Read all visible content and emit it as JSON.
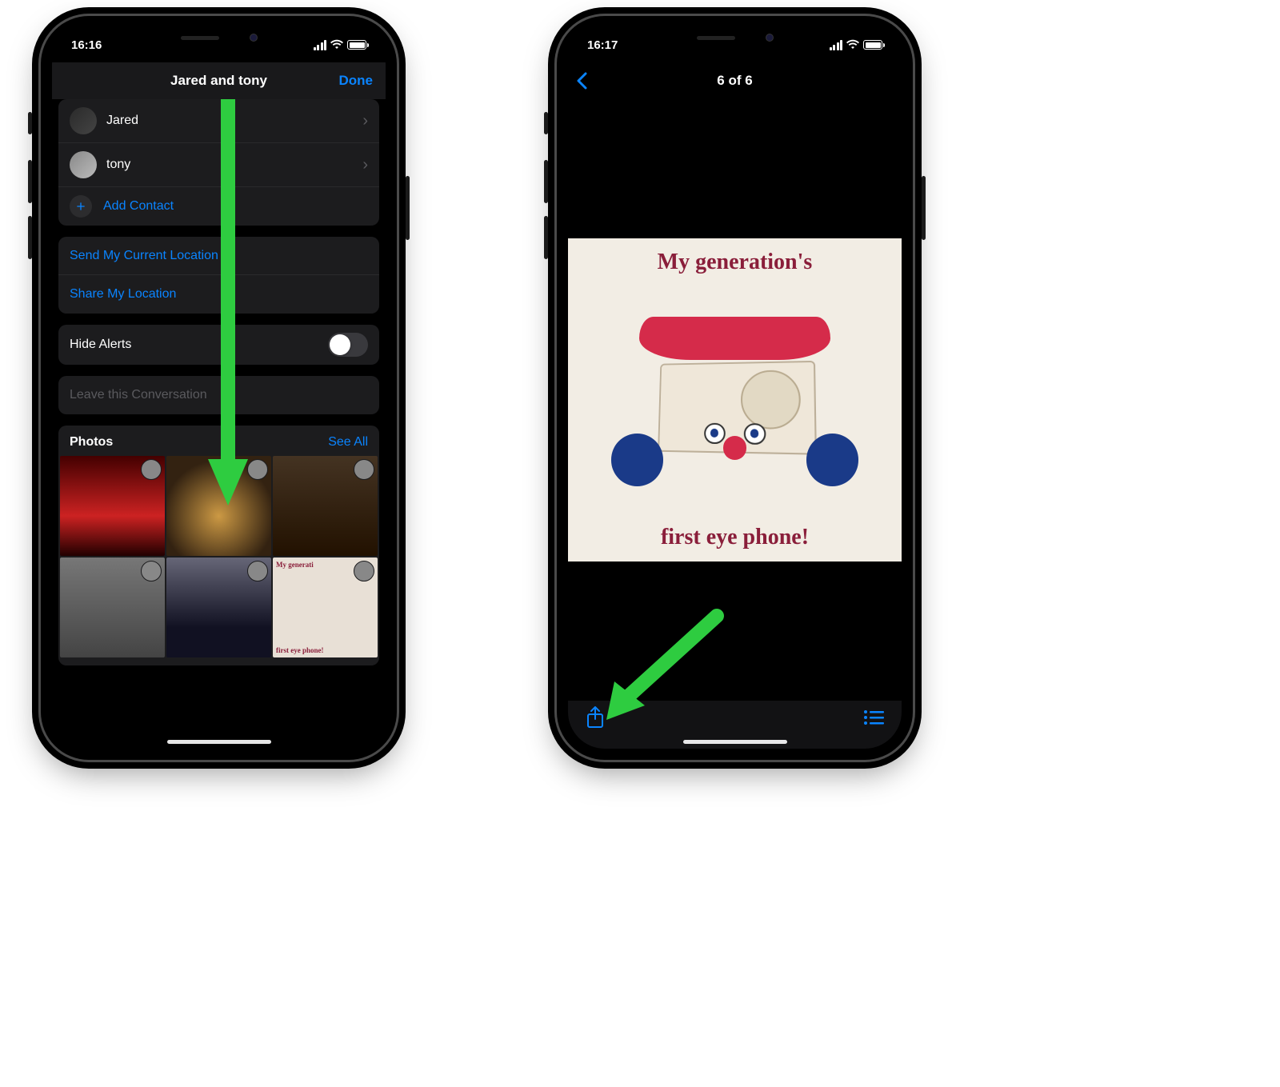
{
  "screen1": {
    "status_time": "16:16",
    "title": "Jared and tony",
    "done": "Done",
    "contacts": [
      {
        "name": "Jared"
      },
      {
        "name": "tony"
      }
    ],
    "add_contact": "Add Contact",
    "send_location": "Send My Current Location",
    "share_location": "Share My Location",
    "hide_alerts": "Hide Alerts",
    "hide_alerts_on": false,
    "leave_conversation": "Leave this Conversation",
    "photos_label": "Photos",
    "see_all": "See All",
    "meme_thumb_top": "My generati",
    "meme_thumb_bottom": "first eye phone!"
  },
  "screen2": {
    "status_time": "16:17",
    "counter": "6 of 6",
    "meme_top": "My generation's",
    "meme_bottom": "first eye phone!"
  },
  "colors": {
    "accent": "#0a84ff",
    "arrow": "#2ecc40"
  }
}
